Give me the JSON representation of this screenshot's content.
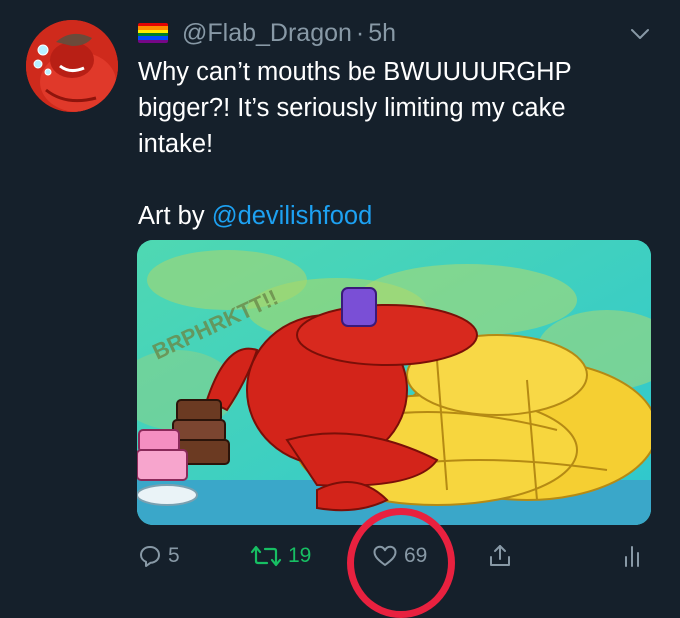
{
  "tweet": {
    "handle": "@Flab_Dragon",
    "separator": "·",
    "time": "5h",
    "text_lines": [
      "Why can’t mouths be BWUUUURGHP",
      "bigger?! It’s seriously limiting my cake",
      "intake!"
    ],
    "credit_prefix": "Art by ",
    "credit_mention": "@devilishfood"
  },
  "media": {
    "sfx_text": "BRPHRKTT!!",
    "colors": {
      "sky": "#3fd2c0",
      "dragon_red": "#d3241a",
      "belly_yellow": "#f5cf32",
      "cake_brown": "#6b3a22",
      "cake_pink": "#f48fc1"
    }
  },
  "actions": {
    "reply": {
      "icon": "reply-icon",
      "count": "5"
    },
    "retweet": {
      "icon": "retweet-icon",
      "count": "19"
    },
    "like": {
      "icon": "heart-icon",
      "count": "69"
    },
    "share": {
      "icon": "share-icon"
    },
    "analytics": {
      "icon": "analytics-icon"
    }
  },
  "colors": {
    "background": "#15202b",
    "secondary_text": "#8899a6",
    "link": "#1da1f2",
    "retweet_green": "#17bf63",
    "annotation_red": "#e8213f"
  }
}
